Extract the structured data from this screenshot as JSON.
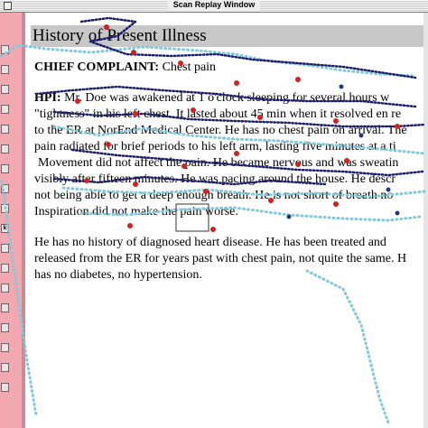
{
  "window": {
    "title": "Scan Replay Window"
  },
  "toolbar": {
    "buttons": [
      "",
      "",
      "",
      "",
      "",
      "",
      "",
      "",
      "",
      "k",
      "",
      "",
      "",
      "",
      "",
      "",
      "",
      ""
    ]
  },
  "document": {
    "heading": "History of Present Illness",
    "chief_complaint_label": "CHIEF COMPLAINT:",
    "chief_complaint_value": "Chest pain",
    "hpi_label": "HPI:",
    "hpi_lines": [
      "Mr. Doe was awakened at 1 o'clock sleeping for several hours w",
      "\"tightness\" in his left chest. It lasted about 45 min when it resolved en re",
      "to the ER at NorEnd Medical Center. He has no chest pain on arrival. The",
      "pain radiated for brief periods to his left arm, lasting five minutes at a ti",
      "Movement did not affect the pain. He became nervous and was sweatin",
      "visibly after fifteen minutes. He was pacing around the house. He descr",
      "not being able to get a deep enough breath. He is not short of breath no",
      "Inspiration did not make the pain worse."
    ],
    "history_lines": [
      "He has no history of diagnosed heart disease. He has been treated and",
      "released from the ER for years past with chest pain, not quite the same. H",
      "has no diabetes, no hypertension."
    ]
  },
  "colors": {
    "scanpath_dark": "#1b1f6b",
    "scanpath_light": "#7fc9dc",
    "fixation": "#d62020",
    "sidebar": "#f2a8b0"
  }
}
